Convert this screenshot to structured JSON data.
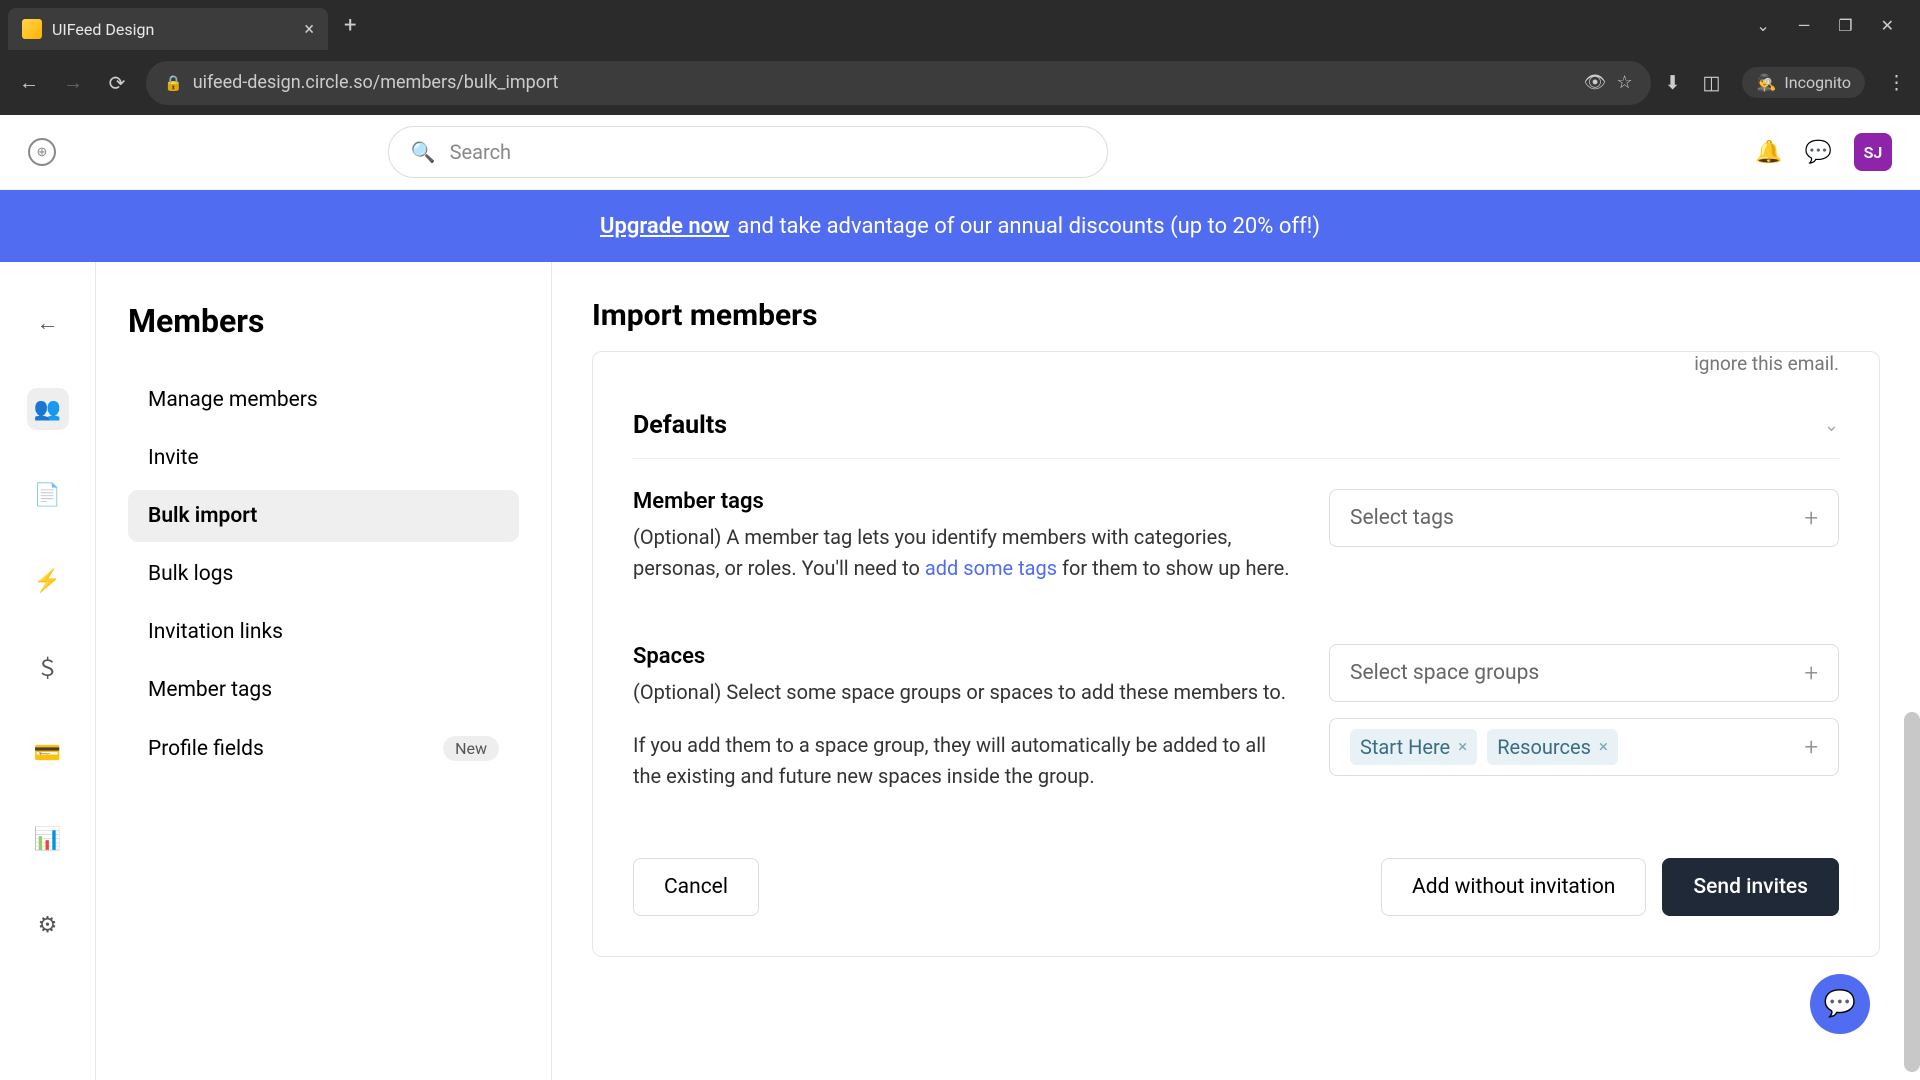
{
  "browser": {
    "tab_title": "UIFeed Design",
    "url": "uifeed-design.circle.so/members/bulk_import",
    "incognito_label": "Incognito"
  },
  "header": {
    "search_placeholder": "Search",
    "avatar_initials": "SJ"
  },
  "banner": {
    "link_text": "Upgrade now",
    "rest_text": " and take advantage of our annual discounts (up to 20% off!)"
  },
  "sidebar": {
    "title": "Members",
    "items": [
      {
        "label": "Manage members"
      },
      {
        "label": "Invite"
      },
      {
        "label": "Bulk import"
      },
      {
        "label": "Bulk logs"
      },
      {
        "label": "Invitation links"
      },
      {
        "label": "Member tags"
      },
      {
        "label": "Profile fields",
        "badge": "New"
      }
    ]
  },
  "page": {
    "title": "Import members",
    "clipped_text": "ignore this email.",
    "defaults_heading": "Defaults",
    "member_tags": {
      "title": "Member tags",
      "desc_prefix": "(Optional) A member tag lets you identify members with categories, personas, or roles. You'll need to ",
      "desc_link": "add some tags",
      "desc_suffix": " for them to show up here.",
      "select_placeholder": "Select tags"
    },
    "spaces": {
      "title": "Spaces",
      "desc1": "(Optional) Select some space groups or spaces to add these members to.",
      "desc2": "If you add them to a space group, they will automatically be added to all the existing and future new spaces inside the group.",
      "select_groups_placeholder": "Select space groups",
      "chips": [
        "Start Here",
        "Resources"
      ]
    },
    "actions": {
      "cancel": "Cancel",
      "add_without": "Add without invitation",
      "send": "Send invites"
    }
  }
}
